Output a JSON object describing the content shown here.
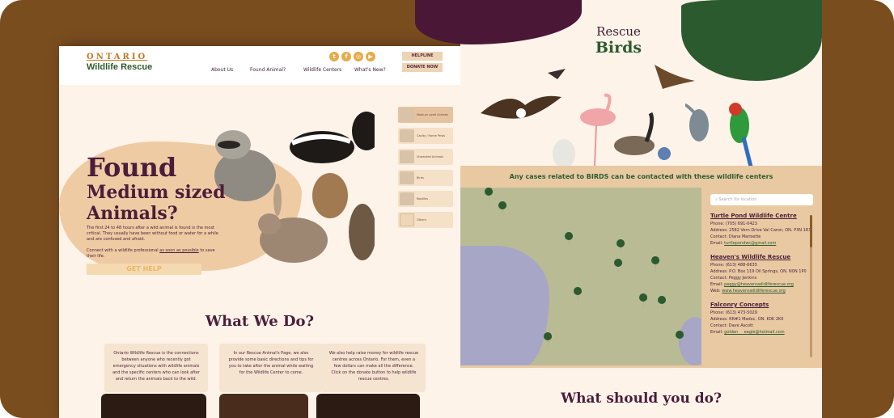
{
  "left": {
    "logo": {
      "top": "ONTARIO",
      "bottom": "Wildlife Rescue"
    },
    "nav": [
      "About Us",
      "Found Animal?",
      "Wildlife Centers",
      "What's New?"
    ],
    "social": [
      "twitter-icon",
      "facebook-icon",
      "instagram-icon",
      "youtube-icon"
    ],
    "helpline": "HELPLINE",
    "donate": "DONATE NOW",
    "hero": {
      "h1": "Found",
      "h2a": "Medium sized",
      "h2b": "Animals?",
      "p1": "The first 24 to 48 hours after a wild animal is found is the most critical. They usually have been without food or water for a while and are confused and afraid.",
      "p2_pre": "Connect with a wildlife professional ",
      "p2_link": "as soon as possible",
      "p2_post": " to save their life.",
      "cta": "GET HELP"
    },
    "side": [
      "Medium sized Animals",
      "Cavity / Home Pests",
      "Unwanted Animals",
      "Birds",
      "Reptiles",
      "Others"
    ],
    "wwd": "What We Do?",
    "cards": [
      "Ontario Wildlife Rescue is the connections between anyone who recently got emergency situations with wildlife animals and the specific centers who can look after and return the animals back to the wild.",
      "In our Rescue Animal's Page, we also provide some basic directions and tips for you to take after the animal while waiting for the Wildlife Center to come.",
      "We also help raise money for wildlife rescue centres across Ontario. For them, even a few dollars can make all the difference. Click on the donate button to help wildlife rescue centres."
    ]
  },
  "right": {
    "rescue": "Rescue",
    "birds": "Birds",
    "strip_title": "Any cases related to BIRDS can be contacted with these wildlife centers",
    "search_placeholder": "Search for location",
    "centers": [
      {
        "name": "Turtle Pond Wildlife Centre",
        "phone": "Phone: (705) 691-0423",
        "address": "Address: 2582 Vern Drive Val Caron, ON. P3N 1R3",
        "contact": "Contact: Diana Marisette",
        "email_label": "Email: ",
        "email": "turtlepondwc@gmail.com"
      },
      {
        "name": "Heaven's Wildlife Rescue",
        "phone": "Phone: (613) 488-6635",
        "address": "Address: P.O. Box 119 Oil Springs, ON. N0N 1P0",
        "contact": "Contact: Peggy Jenkins",
        "email_label": "Email: ",
        "email": "peggy@heavenswildliferescue.org",
        "web_label": "Web: ",
        "web": "www.heavenswildliferescue.org"
      },
      {
        "name": "Falconry Concepts",
        "phone": "Phone: (613) 473-5029",
        "address": "Address: RR#1 Madoc, ON. K0K 2K0",
        "contact": "Contact: Dave Ascott",
        "email_label": "Email: ",
        "email": "golden___eagle@hotmail.com"
      }
    ],
    "what_should": "What should you do?"
  },
  "colors": {
    "plum": "#4b1d3a",
    "green": "#2c5a2f",
    "tan": "#e8c9a2",
    "frame": "#7a4d1f"
  }
}
